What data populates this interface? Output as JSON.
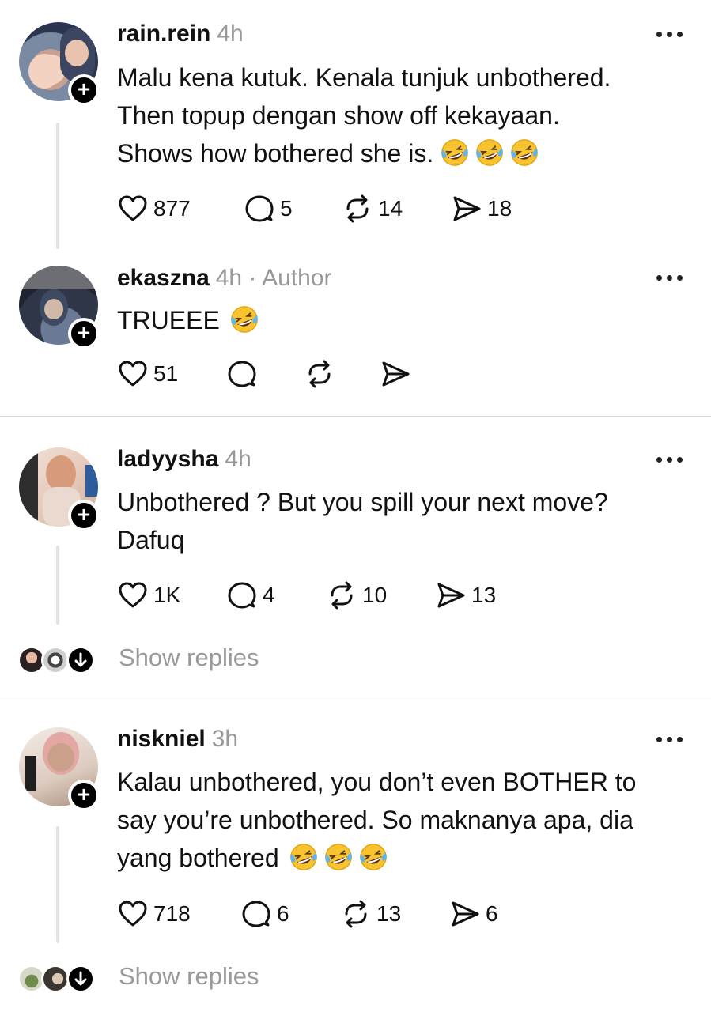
{
  "colors": {
    "text": "#111111",
    "muted": "#999999",
    "divider": "#d9d9d9",
    "thread_line": "#e3e3e3"
  },
  "posts": [
    {
      "username": "rain.rein",
      "time": "4h",
      "author_tag": "",
      "lines": [
        "Malu kena kutuk. Kenala tunjuk unbothered.",
        "Then topup dengan show off kekayaan.",
        "Shows how bothered she is."
      ],
      "emoji_count": 3,
      "likes": "877",
      "comments": "5",
      "reposts": "14",
      "shares": "18"
    },
    {
      "username": "ekaszna",
      "time": "4h",
      "author_tag": "· Author",
      "lines": [
        "TRUEEE"
      ],
      "emoji_count": 1,
      "likes": "51",
      "comments": "",
      "reposts": "",
      "shares": ""
    },
    {
      "username": "ladyysha",
      "time": "4h",
      "author_tag": "",
      "lines": [
        "Unbothered ? But you spill your next move?",
        "Dafuq"
      ],
      "emoji_count": 0,
      "likes": "1K",
      "comments": "4",
      "reposts": "10",
      "shares": "13"
    },
    {
      "username": "niskniel",
      "time": "3h",
      "author_tag": "",
      "lines": [
        "Kalau unbothered, you don’t even BOTHER to",
        "say you’re unbothered. So maknanya apa, dia",
        "yang bothered"
      ],
      "emoji_count": 3,
      "likes": "718",
      "comments": "6",
      "reposts": "13",
      "shares": "6"
    }
  ],
  "show_replies_label": "Show replies",
  "icons": [
    "plus-icon",
    "more-icon",
    "heart-icon",
    "comment-icon",
    "repost-icon",
    "share-icon",
    "laughing-emoji",
    "arrow-down-icon"
  ]
}
